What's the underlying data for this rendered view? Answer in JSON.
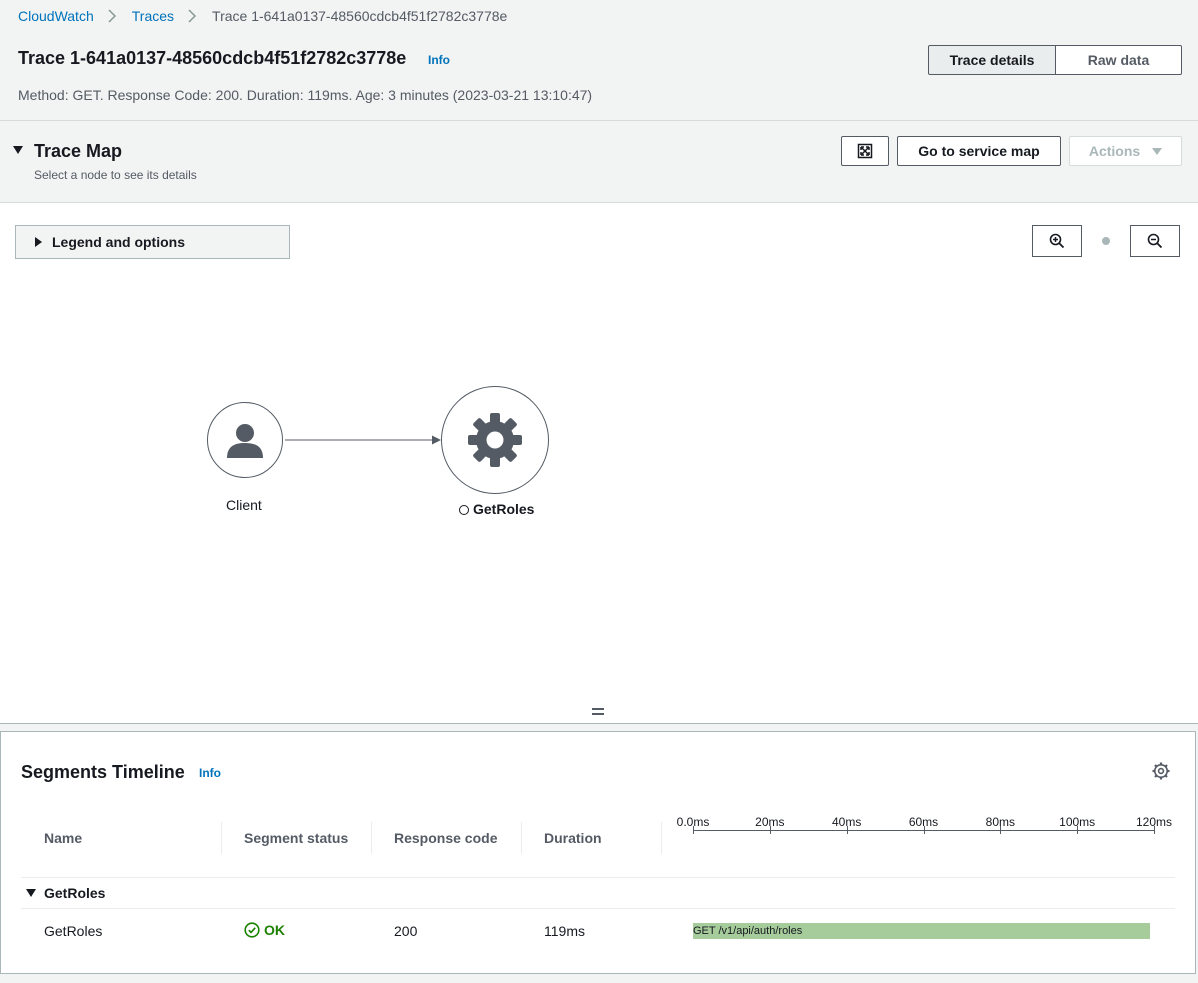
{
  "breadcrumb": {
    "items": [
      "CloudWatch",
      "Traces"
    ],
    "current": "Trace 1-641a0137-48560cdcb4f51f2782c3778e"
  },
  "header": {
    "title": "Trace 1-641a0137-48560cdcb4f51f2782c3778e",
    "info": "Info",
    "meta": "Method: GET. Response Code: 200. Duration: 119ms. Age: 3 minutes (2023-03-21 13:10:47)",
    "tabs": [
      "Trace details",
      "Raw data"
    ],
    "active_tab": "Trace details"
  },
  "trace_map": {
    "title": "Trace Map",
    "subtitle": "Select a node to see its details",
    "go_to_service_map": "Go to service map",
    "actions": "Actions",
    "legend": "Legend and options",
    "nodes": [
      {
        "label": "Client",
        "icon": "user-icon"
      },
      {
        "label": "GetRoles",
        "icon": "gear-icon"
      }
    ]
  },
  "timeline": {
    "title": "Segments Timeline",
    "info": "Info",
    "columns": [
      "Name",
      "Segment status",
      "Response code",
      "Duration"
    ],
    "axis_ticks": [
      "0.0ms",
      "20ms",
      "40ms",
      "60ms",
      "80ms",
      "100ms",
      "120ms"
    ],
    "group": "GetRoles",
    "rows": [
      {
        "name": "GetRoles",
        "status": "OK",
        "response_code": "200",
        "duration": "119ms",
        "bar_label": "GET /v1/api/auth/roles",
        "start_ms": 0,
        "duration_ms": 119
      }
    ]
  },
  "colors": {
    "link": "#0073bb",
    "ok_status": "#1d8102",
    "segment_bar": "#a6cc9b"
  }
}
